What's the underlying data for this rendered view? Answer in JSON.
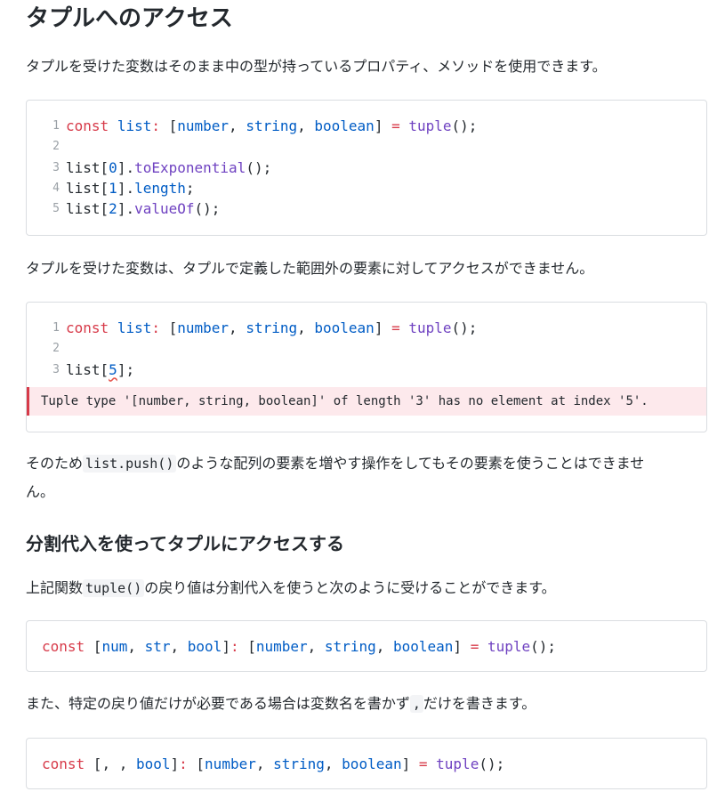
{
  "section1": {
    "heading": "タプルへのアクセス",
    "para1": "タプルを受けた変数はそのまま中の型が持っているプロパティ、メソッドを使用できます。",
    "para2": "タプルを受けた変数は、タプルで定義した範囲外の要素に対してアクセスができません。",
    "para3_before": "そのため",
    "para3_code": "list.push()",
    "para3_after": "のような配列の要素を増やす操作をしてもその要素を使うことはできませ",
    "para3_line2": "ん。"
  },
  "code1": {
    "line_numbers": [
      "1",
      "2",
      "3",
      "4",
      "5"
    ],
    "l1": {
      "kw": "const",
      "var": "list",
      "colon": ":",
      "lb": " [",
      "t1": "number",
      "c1": ", ",
      "t2": "string",
      "c2": ", ",
      "t3": "boolean",
      "rb": "] ",
      "eq": "=",
      "fn": "tuple",
      "end": "();"
    },
    "l3": {
      "a": "list[",
      "n": "0",
      "b": "].",
      "m": "toExponential",
      "c": "();"
    },
    "l4": {
      "a": "list[",
      "n": "1",
      "b": "].",
      "m": "length",
      "c": ";"
    },
    "l5": {
      "a": "list[",
      "n": "2",
      "b": "].",
      "m": "valueOf",
      "c": "();"
    }
  },
  "code2": {
    "line_numbers": [
      "1",
      "2",
      "3"
    ],
    "l3": {
      "a": "list[",
      "n": "5",
      "c": "];"
    },
    "error": "Tuple type '[number, string, boolean]' of length '3' has no element at index '5'."
  },
  "section2": {
    "heading": "分割代入を使ってタプルにアクセスする",
    "para1_before": "上記関数",
    "para1_code": "tuple()",
    "para1_after": "の戻り値は分割代入を使うと次のように受けることができます。",
    "para2_before": "また、特定の戻り値だけが必要である場合は変数名を書かず",
    "para2_code": ",",
    "para2_after": "だけを書きます。"
  },
  "code3": {
    "kw": "const",
    "p1": " [",
    "a": "num",
    "s1": ", ",
    "b": "str",
    "s2": ", ",
    "c": "bool",
    "p2": "]",
    "colon": ":"
  },
  "code4": {
    "kw": "const",
    "p1": " [, , ",
    "c": "bool",
    "p2": "]",
    "colon": ":"
  }
}
